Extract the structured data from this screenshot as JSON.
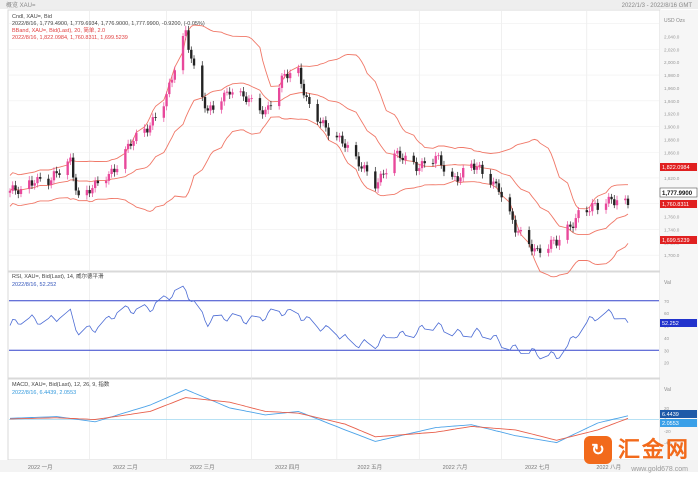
{
  "window": {
    "title_left": "概览  XAU=",
    "title_right": "2022/1/3 - 2022/8/16 GMT"
  },
  "price_panel": {
    "legend": [
      "Cndl, XAU=, Bid",
      "2022/8/16, 1,779.4900, 1,779.6934, 1,776.9000, 1,777.9900, -0.9200, (-0.05%)",
      "BBand, XAU=, Bid(Last), 20, 简单, 2.0",
      "2022/8/16, 1,822.0984, 1,760.8311, 1,699.5239"
    ],
    "unit": "USD\nOzs",
    "badges": {
      "upper": "1,822.0984",
      "close": "1,777.9900",
      "middle": "1,760.8311",
      "lower": "1,699.5239"
    }
  },
  "rsi_panel": {
    "legend": [
      "RSI, XAU=, Bid(Last), 14, 威尔德平滑",
      "2022/8/16, 52.252"
    ],
    "unit": "Val",
    "badge": "52.252",
    "levels": [
      70,
      30
    ]
  },
  "macd_panel": {
    "legend": [
      "MACD, XAU=, Bid(Last), 12, 26, 9, 指数",
      "2022/8/16, 6.4439, 2.0553"
    ],
    "unit": "Val",
    "badges": {
      "macd": "6.4439",
      "signal": "2.0553"
    }
  },
  "x_axis": {
    "labels": [
      "2022 一月",
      "2022 二月",
      "2022 三月",
      "2022 四月",
      "2022 五月",
      "2022 六月",
      "2022 七月",
      "2022 八月"
    ]
  },
  "watermark": {
    "text": "汇金网",
    "url": "www.gold678.com",
    "icon": "gold678-logo-icon"
  },
  "colors": {
    "up_candle": "#e8489b",
    "down_candle": "#222222",
    "bollinger": "#f07868",
    "rsi_line": "#4b6bd4",
    "macd_line": "#4da3e8",
    "signal_line": "#e8604c",
    "ref_line": "#3344cc"
  },
  "chart_data": [
    {
      "type": "candlestick",
      "title": "Cndl, XAU=, Bid",
      "x_start": "2022-01-03",
      "x_end": "2022-08-16",
      "ylim": [
        1680,
        2075
      ],
      "close_path": [
        {
          "date": "2022-01-03",
          "close": 1800
        },
        {
          "date": "2022-01-07",
          "close": 1797
        },
        {
          "date": "2022-01-12",
          "close": 1820
        },
        {
          "date": "2022-01-18",
          "close": 1815
        },
        {
          "date": "2022-01-25",
          "close": 1848
        },
        {
          "date": "2022-01-28",
          "close": 1790
        },
        {
          "date": "2022-02-03",
          "close": 1805
        },
        {
          "date": "2022-02-10",
          "close": 1836
        },
        {
          "date": "2022-02-16",
          "close": 1872
        },
        {
          "date": "2022-02-23",
          "close": 1905
        },
        {
          "date": "2022-03-01",
          "close": 1944
        },
        {
          "date": "2022-03-08",
          "close": 2050
        },
        {
          "date": "2022-03-11",
          "close": 1990
        },
        {
          "date": "2022-03-16",
          "close": 1918
        },
        {
          "date": "2022-03-24",
          "close": 1960
        },
        {
          "date": "2022-03-31",
          "close": 1938
        },
        {
          "date": "2022-04-06",
          "close": 1925
        },
        {
          "date": "2022-04-13",
          "close": 1977
        },
        {
          "date": "2022-04-18",
          "close": 1985
        },
        {
          "date": "2022-04-22",
          "close": 1932
        },
        {
          "date": "2022-04-28",
          "close": 1893
        },
        {
          "date": "2022-05-05",
          "close": 1877
        },
        {
          "date": "2022-05-10",
          "close": 1840
        },
        {
          "date": "2022-05-16",
          "close": 1811
        },
        {
          "date": "2022-05-23",
          "close": 1855
        },
        {
          "date": "2022-05-31",
          "close": 1840
        },
        {
          "date": "2022-06-07",
          "close": 1850
        },
        {
          "date": "2022-06-13",
          "close": 1818
        },
        {
          "date": "2022-06-20",
          "close": 1840
        },
        {
          "date": "2022-06-30",
          "close": 1807
        },
        {
          "date": "2022-07-06",
          "close": 1738
        },
        {
          "date": "2022-07-14",
          "close": 1708
        },
        {
          "date": "2022-07-21",
          "close": 1718
        },
        {
          "date": "2022-07-29",
          "close": 1765
        },
        {
          "date": "2022-08-05",
          "close": 1775
        },
        {
          "date": "2022-08-10",
          "close": 1790
        },
        {
          "date": "2022-08-16",
          "close": 1778
        }
      ],
      "last": {
        "date": "2022-08-16",
        "open": 1779.49,
        "high": 1779.6934,
        "low": 1776.9,
        "close": 1777.99,
        "change": -0.92,
        "change_pct": -0.05
      },
      "bollinger": {
        "period": 20,
        "stddev": 2.0,
        "last": {
          "upper": 1822.0984,
          "middle": 1760.8311,
          "lower": 1699.5239
        }
      }
    },
    {
      "type": "line",
      "title": "RSI, XAU=, Bid(Last), 14, 威尔德平滑",
      "ylim": [
        10,
        90
      ],
      "reference_lines": [
        70,
        30
      ],
      "points": [
        {
          "date": "2022-01-03",
          "value": 50
        },
        {
          "date": "2022-01-12",
          "value": 55
        },
        {
          "date": "2022-01-25",
          "value": 58
        },
        {
          "date": "2022-01-28",
          "value": 43
        },
        {
          "date": "2022-02-10",
          "value": 58
        },
        {
          "date": "2022-02-23",
          "value": 66
        },
        {
          "date": "2022-03-08",
          "value": 78
        },
        {
          "date": "2022-03-16",
          "value": 54
        },
        {
          "date": "2022-03-31",
          "value": 56
        },
        {
          "date": "2022-04-18",
          "value": 61
        },
        {
          "date": "2022-04-28",
          "value": 45
        },
        {
          "date": "2022-05-16",
          "value": 33
        },
        {
          "date": "2022-05-23",
          "value": 43
        },
        {
          "date": "2022-06-07",
          "value": 48
        },
        {
          "date": "2022-06-20",
          "value": 44
        },
        {
          "date": "2022-06-30",
          "value": 38
        },
        {
          "date": "2022-07-14",
          "value": 25
        },
        {
          "date": "2022-07-21",
          "value": 27
        },
        {
          "date": "2022-08-05",
          "value": 58
        },
        {
          "date": "2022-08-10",
          "value": 62
        },
        {
          "date": "2022-08-16",
          "value": 52.252
        }
      ]
    },
    {
      "type": "line",
      "title": "MACD, XAU=, Bid(Last), 12, 26, 9, 指数",
      "ylim": [
        -65,
        65
      ],
      "series": [
        {
          "values_last": 6.4439,
          "points": [
            {
              "date": "2022-01-03",
              "value": 2
            },
            {
              "date": "2022-01-20",
              "value": 5
            },
            {
              "date": "2022-02-03",
              "value": -4
            },
            {
              "date": "2022-02-23",
              "value": 25
            },
            {
              "date": "2022-03-08",
              "value": 52
            },
            {
              "date": "2022-03-24",
              "value": 20
            },
            {
              "date": "2022-04-06",
              "value": 8
            },
            {
              "date": "2022-04-18",
              "value": 14
            },
            {
              "date": "2022-05-05",
              "value": -18
            },
            {
              "date": "2022-05-16",
              "value": -38
            },
            {
              "date": "2022-06-07",
              "value": -14
            },
            {
              "date": "2022-06-20",
              "value": -9
            },
            {
              "date": "2022-07-06",
              "value": -28
            },
            {
              "date": "2022-07-21",
              "value": -40
            },
            {
              "date": "2022-08-05",
              "value": -6
            },
            {
              "date": "2022-08-16",
              "value": 6.4439
            }
          ]
        },
        {
          "values_last": 2.0553,
          "points": [
            {
              "date": "2022-01-03",
              "value": 1
            },
            {
              "date": "2022-01-20",
              "value": 3
            },
            {
              "date": "2022-02-03",
              "value": 0
            },
            {
              "date": "2022-02-23",
              "value": 14
            },
            {
              "date": "2022-03-08",
              "value": 38
            },
            {
              "date": "2022-03-24",
              "value": 30
            },
            {
              "date": "2022-04-06",
              "value": 14
            },
            {
              "date": "2022-04-18",
              "value": 11
            },
            {
              "date": "2022-05-05",
              "value": -8
            },
            {
              "date": "2022-05-16",
              "value": -30
            },
            {
              "date": "2022-06-07",
              "value": -22
            },
            {
              "date": "2022-06-20",
              "value": -12
            },
            {
              "date": "2022-07-06",
              "value": -18
            },
            {
              "date": "2022-07-21",
              "value": -36
            },
            {
              "date": "2022-08-05",
              "value": -18
            },
            {
              "date": "2022-08-16",
              "value": 2.0553
            }
          ]
        }
      ]
    }
  ]
}
